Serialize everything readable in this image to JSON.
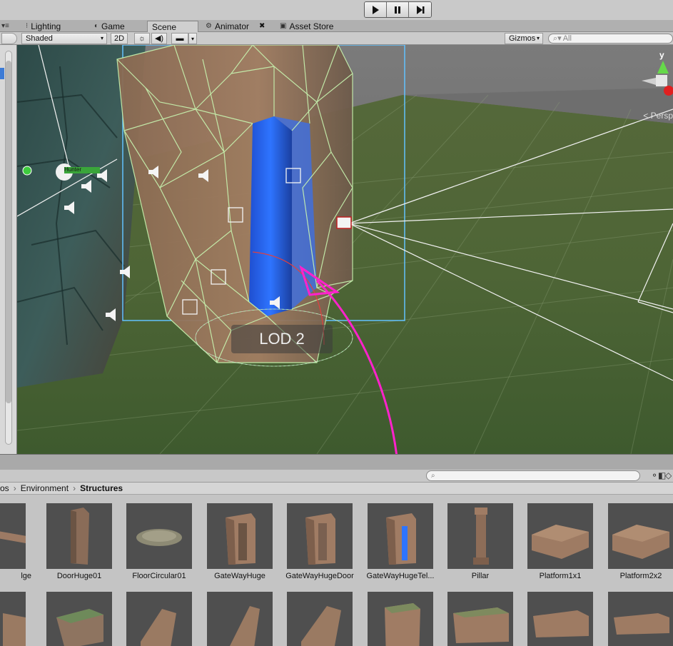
{
  "toolbar": {
    "play_icon": "play-icon",
    "pause_icon": "pause-icon",
    "step_icon": "step-icon"
  },
  "tabs": [
    {
      "label": "Lighting",
      "icon": "lighting-icon"
    },
    {
      "label": "Game",
      "icon": "game-icon"
    },
    {
      "label": "Scene",
      "icon": "scene-icon",
      "active": true
    },
    {
      "label": "Animator",
      "icon": "animator-icon",
      "close": "✖"
    },
    {
      "label": "Asset Store",
      "icon": "asset-store-icon"
    }
  ],
  "scene_toolbar": {
    "shading_mode": "Shaded",
    "mode_2d": "2D",
    "gizmos": "Gizmos",
    "search_placeholder": "All"
  },
  "viewport": {
    "lod_label": "LOD 2",
    "persp_label": "< Persp",
    "axis_y": "y",
    "object_label": "Hunter",
    "colors": {
      "wireframe": "#c8f5b0",
      "portal": "#2a68ff",
      "annotation_arrow": "#ff22cc",
      "selection_box": "#62c2ff"
    }
  },
  "project": {
    "search_placeholder": "",
    "breadcrumb": [
      "os",
      "Environment",
      "Structures"
    ],
    "assets_row1": [
      {
        "name": "lge"
      },
      {
        "name": "DoorHuge01"
      },
      {
        "name": "FloorCircular01"
      },
      {
        "name": "GateWayHuge"
      },
      {
        "name": "GateWayHugeDoor"
      },
      {
        "name": "GateWayHugeTel..."
      },
      {
        "name": "Pillar"
      },
      {
        "name": "Platform1x1"
      },
      {
        "name": "Platform2x2"
      }
    ]
  }
}
